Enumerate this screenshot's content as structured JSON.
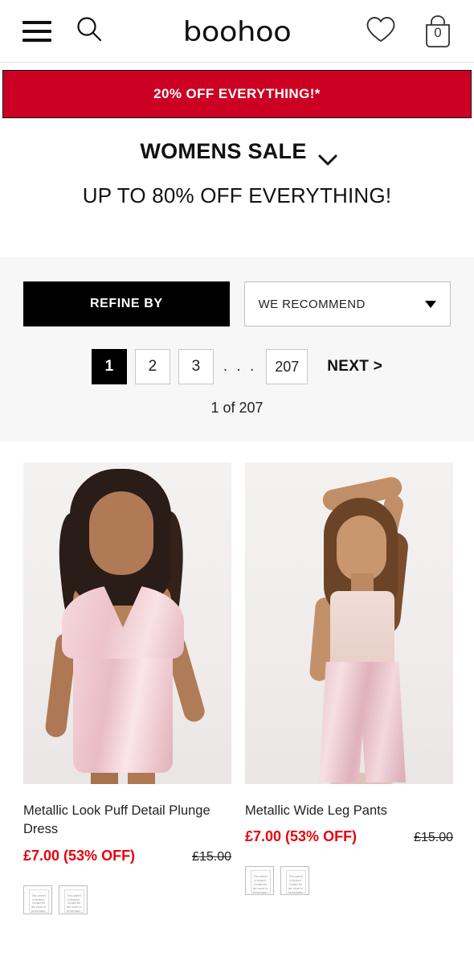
{
  "header": {
    "menu_icon": "hamburger-icon",
    "search_icon": "search-icon",
    "logo_text": "boohoo",
    "wishlist_icon": "heart-icon",
    "bag_icon": "shopping-bag-icon",
    "bag_count": "0"
  },
  "promo": {
    "text": "20% OFF EVERYTHING!*",
    "background_color": "#cc0022",
    "text_color": "#ffffff"
  },
  "category": {
    "title": "WOMENS SALE",
    "chevron_icon": "chevron-down-icon",
    "subtitle": "UP TO 80% OFF EVERYTHING!"
  },
  "filters": {
    "refine_label": "REFINE BY",
    "sort_value": "WE RECOMMEND",
    "sort_caret_icon": "caret-down-icon"
  },
  "pagination": {
    "pages": [
      "1",
      "2",
      "3"
    ],
    "dots": ". . .",
    "last_page": "207",
    "next_label": "NEXT >",
    "active_page": "1",
    "count_label": "1 of 207"
  },
  "products": [
    {
      "name": "Metallic Look Puff Detail Plunge Dress",
      "price_now": "£7.00 (53% OFF)",
      "price_was": "£15.00",
      "price_color": "#e8000d",
      "swatches": [
        "This content is blocked. Contact the site owner to fix the issue.",
        "This content is blocked. Contact the site owner to fix the issue."
      ]
    },
    {
      "name": "Metallic Wide Leg Pants",
      "price_now": "£7.00 (53% OFF)",
      "price_was": "£15.00",
      "price_color": "#e8000d",
      "swatches": [
        "This content is blocked. Contact the site owner to fix the issue.",
        "This content is blocked. Contact the site owner to fix the issue."
      ]
    }
  ]
}
